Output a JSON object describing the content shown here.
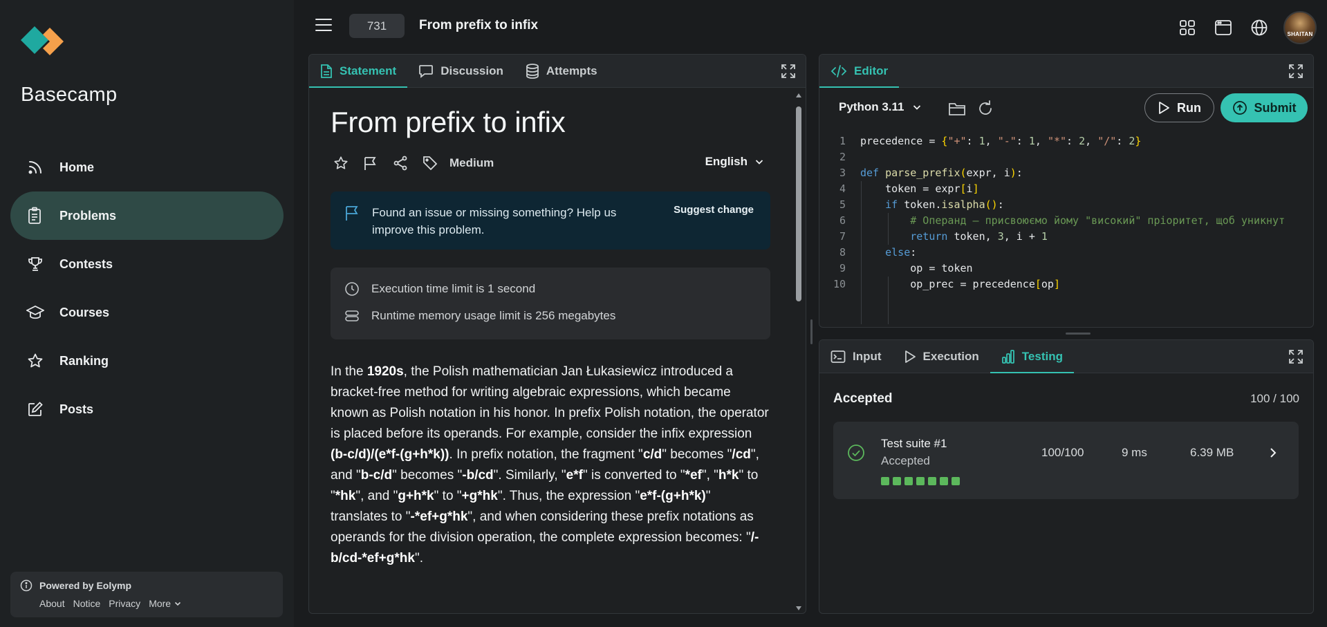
{
  "sidebar": {
    "brand": "Basecamp",
    "items": [
      {
        "label": "Home",
        "icon": "rss-icon"
      },
      {
        "label": "Problems",
        "icon": "clipboard-icon",
        "active": true
      },
      {
        "label": "Contests",
        "icon": "trophy-icon"
      },
      {
        "label": "Courses",
        "icon": "graduation-cap-icon"
      },
      {
        "label": "Ranking",
        "icon": "star-icon"
      },
      {
        "label": "Posts",
        "icon": "edit-icon"
      }
    ],
    "powered": "Powered by Eolymp",
    "links": [
      "About",
      "Notice",
      "Privacy",
      "More"
    ]
  },
  "header": {
    "problem_id": "731",
    "title": "From prefix to infix"
  },
  "statement_panel": {
    "tabs": [
      "Statement",
      "Discussion",
      "Attempts"
    ],
    "heading": "From prefix to infix",
    "difficulty": "Medium",
    "language": "English",
    "notice_text": "Found an issue or missing something? Help us improve this problem.",
    "suggest_label": "Suggest change",
    "time_limit": "Execution time limit is 1 second",
    "memory_limit": "Runtime memory usage limit is 256 megabytes"
  },
  "editor_panel": {
    "tab": "Editor",
    "language": "Python 3.11",
    "run_label": "Run",
    "submit_label": "Submit",
    "line_numbers": [
      "1",
      "2",
      "3",
      "4",
      "5",
      "6",
      "7",
      "8",
      "9",
      "10"
    ]
  },
  "testing_panel": {
    "tabs": [
      "Input",
      "Execution",
      "Testing"
    ],
    "verdict": "Accepted",
    "score": "100 / 100",
    "suite": {
      "name": "Test suite #1",
      "status": "Accepted",
      "points": "100/100",
      "time": "9 ms",
      "memory": "6.39 MB",
      "tests_passed": 7
    }
  },
  "colors": {
    "accent": "#35c2b2",
    "active_nav": "#2f4a46",
    "pass": "#5cb85c"
  }
}
